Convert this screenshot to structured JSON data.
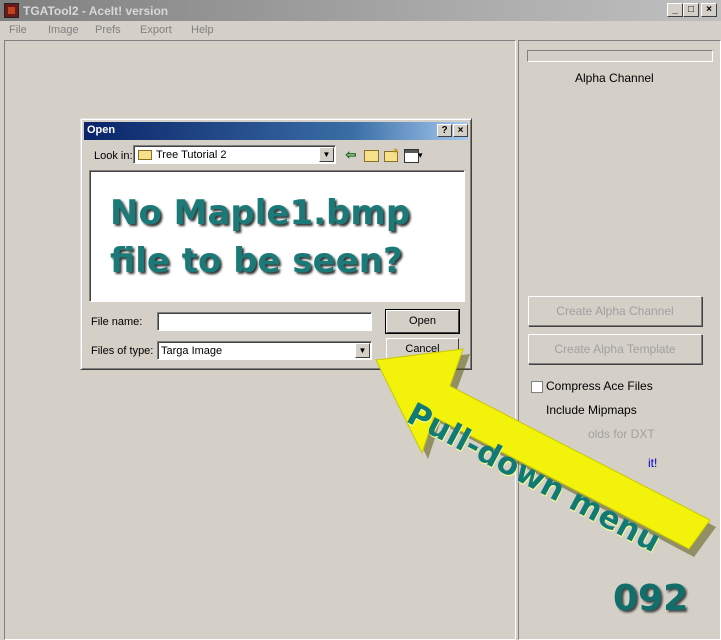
{
  "window": {
    "title": "TGATool2 - AceIt! version",
    "controls": {
      "minimize": "_",
      "maximize": "□",
      "close": "×"
    }
  },
  "menu": [
    "File",
    "Image",
    "Prefs",
    "Export",
    "Help"
  ],
  "right_panel": {
    "alpha_channel_label": "Alpha Channel",
    "create_alpha_channel": "Create Alpha Channel",
    "create_alpha_template": "Create Alpha Template",
    "compress_ace_files": "Compress Ace Files",
    "include_mipmaps": "Include Mipmaps",
    "dxt_partial": "olds for DXT",
    "aceit_partial": "it!"
  },
  "dialog": {
    "title": "Open",
    "help_btn": "?",
    "close_btn": "×",
    "look_in_label": "Look in:",
    "look_in_value": "Tree Tutorial 2",
    "toolbar_icons": [
      "back-arrow-icon",
      "up-folder-icon",
      "new-folder-icon",
      "view-menu-icon"
    ],
    "file_name_label": "File name:",
    "file_name_value": "",
    "files_of_type_label": "Files of type:",
    "files_of_type_value": "Targa Image",
    "open_button": "Open",
    "cancel_button": "Cancel"
  },
  "annotations": {
    "question_line1": "No Maple1.bmp",
    "question_line2": "file to be seen?",
    "arrow_label": "Pull-down menu",
    "arrow_color": "#f2f20a",
    "page_number": "092"
  }
}
